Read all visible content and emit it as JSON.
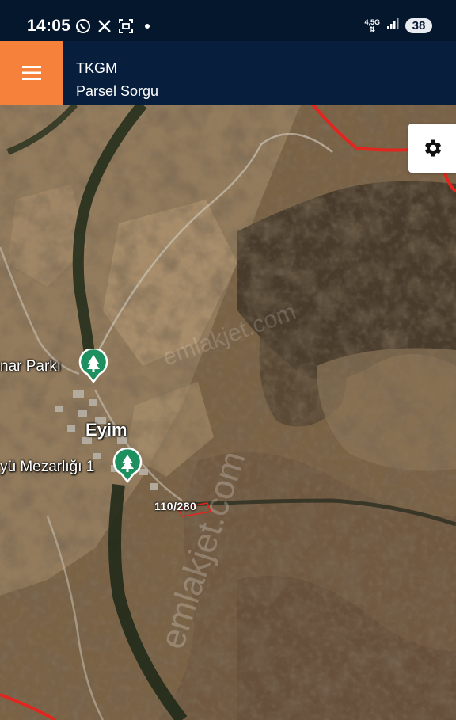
{
  "status_bar": {
    "time": "14:05",
    "notification_icons": [
      "whatsapp-icon",
      "x-icon",
      "screenshot-icon"
    ],
    "network_label": "4,5G",
    "battery": "38"
  },
  "app_bar": {
    "title": "TKGM",
    "subtitle": "Parsel Sorgu",
    "accent_color": "#f5813a",
    "background_color": "#071e3d"
  },
  "map": {
    "labels": {
      "park": "nar Parkı",
      "town": "Eyim",
      "cemetery": "yü Mezarlığı 1"
    },
    "parcel_label": "110/280",
    "watermark": "emlakjet.com",
    "boundary_color": "#e0261f",
    "poi_icon": "tree-icon",
    "poi_color": "#1e8f5e"
  }
}
